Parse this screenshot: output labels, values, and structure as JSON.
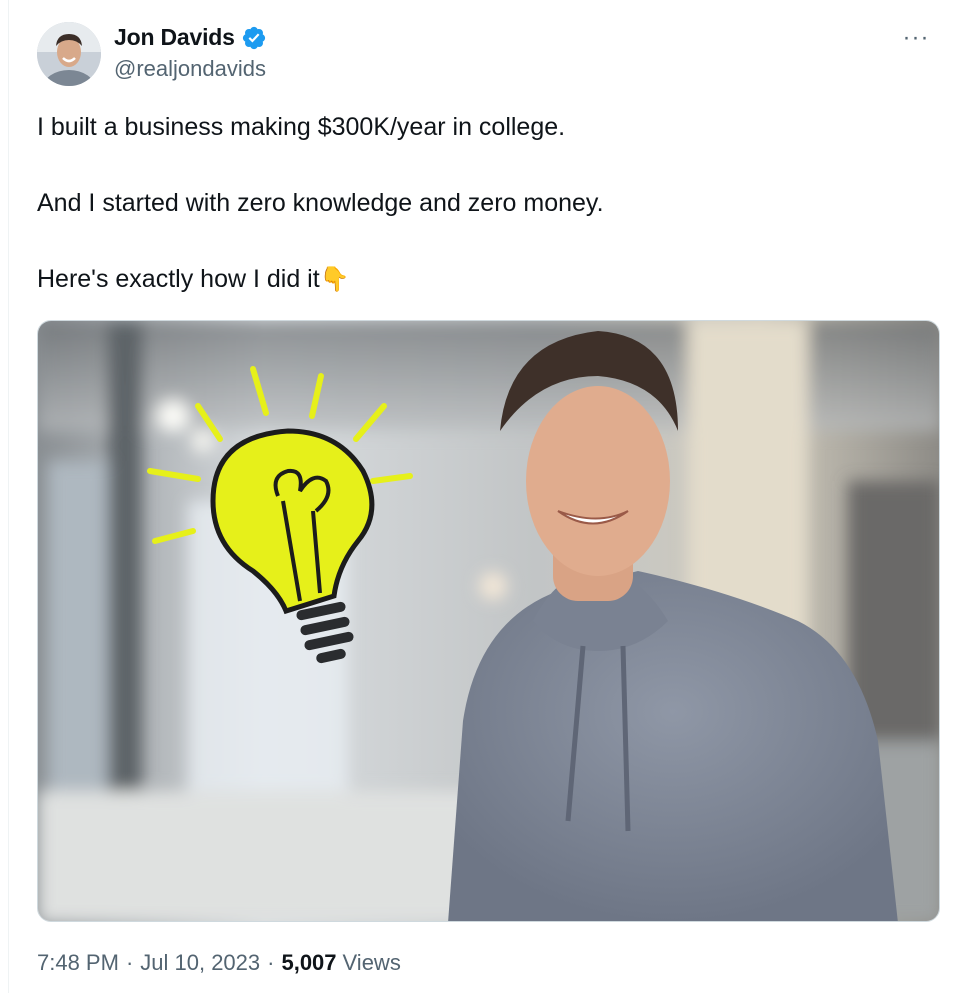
{
  "author": {
    "display_name": "Jon Davids",
    "handle": "@realjondavids",
    "verified": true,
    "verified_icon": "verified-badge-icon",
    "avatar_icon": "avatar"
  },
  "more_icon": "more-options-icon",
  "more_label": "···",
  "tweet": {
    "lines": [
      "I built a business making $300K/year in college.",
      "And I started with zero knowledge and zero money.",
      "Here's exactly how I did it"
    ],
    "emoji": "👇"
  },
  "media": {
    "icon": "lightbulb-icon"
  },
  "meta": {
    "time": "7:48 PM",
    "separator": "·",
    "date": "Jul 10, 2023",
    "views_count": "5,007",
    "views_label": "Views"
  },
  "colors": {
    "verified_blue": "#1d9bf0",
    "secondary_text": "#536471",
    "primary_text": "#0f1419",
    "bulb_yellow": "#e6f01a"
  }
}
